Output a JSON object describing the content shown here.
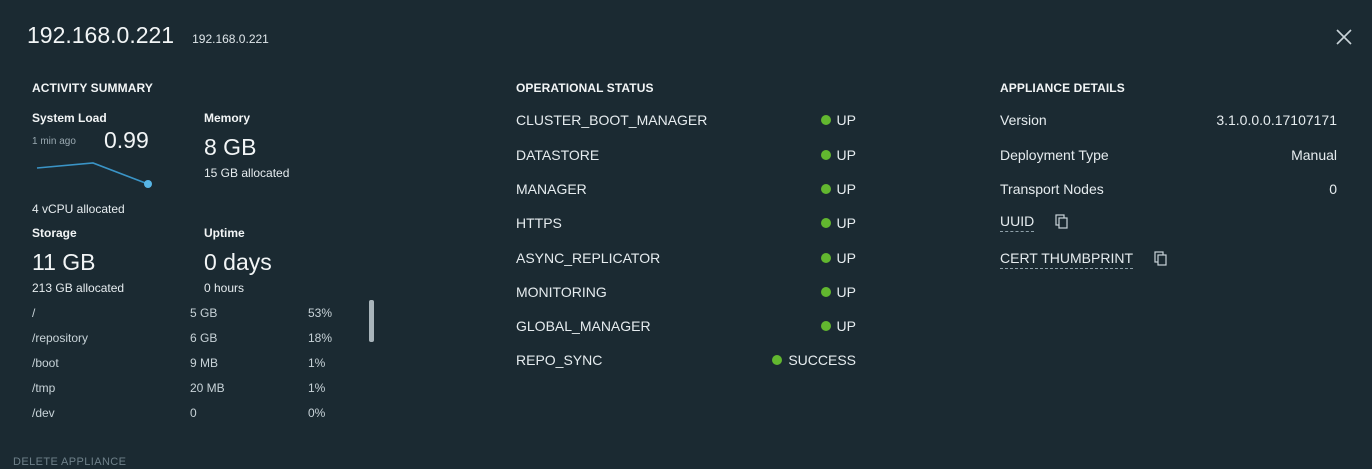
{
  "header": {
    "title": "192.168.0.221",
    "subtitle": "192.168.0.221"
  },
  "activity": {
    "section_title": "ACTIVITY SUMMARY",
    "system_load": {
      "label": "System Load",
      "time": "1 min ago",
      "value": "0.99",
      "cpu": "4 vCPU allocated"
    },
    "memory": {
      "label": "Memory",
      "value": "8 GB",
      "allocated": "15 GB allocated"
    },
    "storage": {
      "label": "Storage",
      "value": "11 GB",
      "allocated": "213 GB allocated"
    },
    "uptime": {
      "label": "Uptime",
      "value": "0 days",
      "hours": "0 hours"
    },
    "partitions": [
      {
        "path": "/",
        "size": "5 GB",
        "pct": "53%"
      },
      {
        "path": "/repository",
        "size": "6 GB",
        "pct": "18%"
      },
      {
        "path": "/boot",
        "size": "9 MB",
        "pct": "1%"
      },
      {
        "path": "/tmp",
        "size": "20 MB",
        "pct": "1%"
      },
      {
        "path": "/dev",
        "size": "0",
        "pct": "0%"
      }
    ]
  },
  "operational": {
    "section_title": "OPERATIONAL STATUS",
    "items": [
      {
        "name": "CLUSTER_BOOT_MANAGER",
        "status": "UP"
      },
      {
        "name": "DATASTORE",
        "status": "UP"
      },
      {
        "name": "MANAGER",
        "status": "UP"
      },
      {
        "name": "HTTPS",
        "status": "UP"
      },
      {
        "name": "ASYNC_REPLICATOR",
        "status": "UP"
      },
      {
        "name": "MONITORING",
        "status": "UP"
      },
      {
        "name": "GLOBAL_MANAGER",
        "status": "UP"
      },
      {
        "name": "REPO_SYNC",
        "status": "SUCCESS"
      }
    ],
    "status_color": "#62b72f"
  },
  "appliance": {
    "section_title": "APPLIANCE DETAILS",
    "version": {
      "label": "Version",
      "value": "3.1.0.0.0.17107171"
    },
    "deployment": {
      "label": "Deployment Type",
      "value": "Manual"
    },
    "transport": {
      "label": "Transport Nodes",
      "value": "0"
    },
    "uuid_label": "UUID",
    "cert_label": "CERT THUMBPRINT"
  },
  "footer": {
    "delete_label": "DELETE APPLIANCE"
  },
  "icons": [
    "close-icon",
    "copy-icon"
  ]
}
